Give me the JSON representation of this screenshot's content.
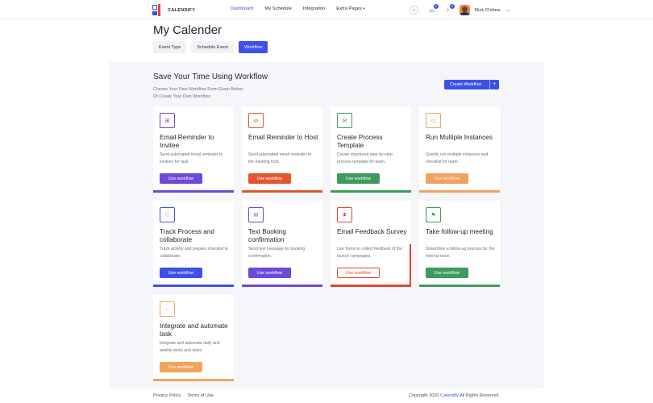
{
  "header": {
    "logo_text": "CALENDIFY",
    "nav": [
      {
        "label": "Dashboard",
        "active": true
      },
      {
        "label": "My Schedule",
        "active": false
      },
      {
        "label": "Integration",
        "active": false
      },
      {
        "label": "Extra Pages",
        "active": false
      }
    ],
    "messages_badge": "2",
    "notifications_badge": "3",
    "user_name": "Rick O'shea"
  },
  "page": {
    "title": "My Calender",
    "tabs": [
      {
        "label": "Event Type",
        "active": false
      },
      {
        "label": "Schedule Event",
        "active": false
      },
      {
        "label": "Workflow",
        "active": true
      }
    ]
  },
  "workflow": {
    "title": "Save Your Time Using Workflow",
    "subtitle_line1": "Choose Your Own Workflow From Given Below.",
    "subtitle_line2": "Or Create Your Own Workflow",
    "create_label": "Create Workflow",
    "create_plus": "+",
    "cards": [
      {
        "title": "Email Reminder to Invitee",
        "desc": "Send automated email reminder to invitees for task.",
        "button": "Use workflow",
        "color": "#6e48d6",
        "icon": "sitemap-icon",
        "glyph": "⊞"
      },
      {
        "title": "Email Reminder to Host",
        "desc": "Send automated email reminder to the meeting host.",
        "button": "Use workflow",
        "color": "#e2552f",
        "icon": "eye-slash-icon",
        "glyph": "⊘"
      },
      {
        "title": "Create Process Template",
        "desc": "Create structured step-by-step process template for team.",
        "button": "Use workflow",
        "color": "#3f9a5f",
        "icon": "envelope-open-icon",
        "glyph": "✉"
      },
      {
        "title": "Run Multiple Instances",
        "desc": "Quickly run multiple instances and checklist for team.",
        "button": "Use workflow",
        "color": "#f2a25b",
        "icon": "clock-icon",
        "glyph": "◷"
      },
      {
        "title": "Track Process and collaborate",
        "desc": "Track activity and prepare checklist to collaborate.",
        "button": "Use workflow",
        "color": "#3d50e8",
        "icon": "handshake-icon",
        "glyph": "♡"
      },
      {
        "title": "Text Booking confirmation",
        "desc": "Send text message for booking confirmation.",
        "button": "Use workflow",
        "color": "#6e48d6",
        "icon": "envelope-icon",
        "glyph": "✉"
      },
      {
        "title": "Email Feedback Survey",
        "desc": "Use forms to collect feedback of the launch campaigns.",
        "button": "Use workflow",
        "color": "#e2462f",
        "icon": "hourglass-icon",
        "glyph": "⧗"
      },
      {
        "title": "Take follow-up meeting",
        "desc": "Streamline a follow-up process for the internal team.",
        "button": "Use workflow",
        "color": "#3f9a5f",
        "icon": "bookmark-icon",
        "glyph": "⚑"
      },
      {
        "title": "Integrate and automate task",
        "desc": "Integrate and automate daily and weekly tasks and sales.",
        "button": "Use workflow",
        "color": "#f2a25b",
        "icon": "fire-icon",
        "glyph": "♨"
      }
    ]
  },
  "footer": {
    "privacy": "Privacy Policy",
    "terms": "Terms of Use",
    "copyright_prefix": "Copyright 2020 ",
    "brand": "Calendify",
    "copyright_suffix": " All Rights Reserved."
  }
}
